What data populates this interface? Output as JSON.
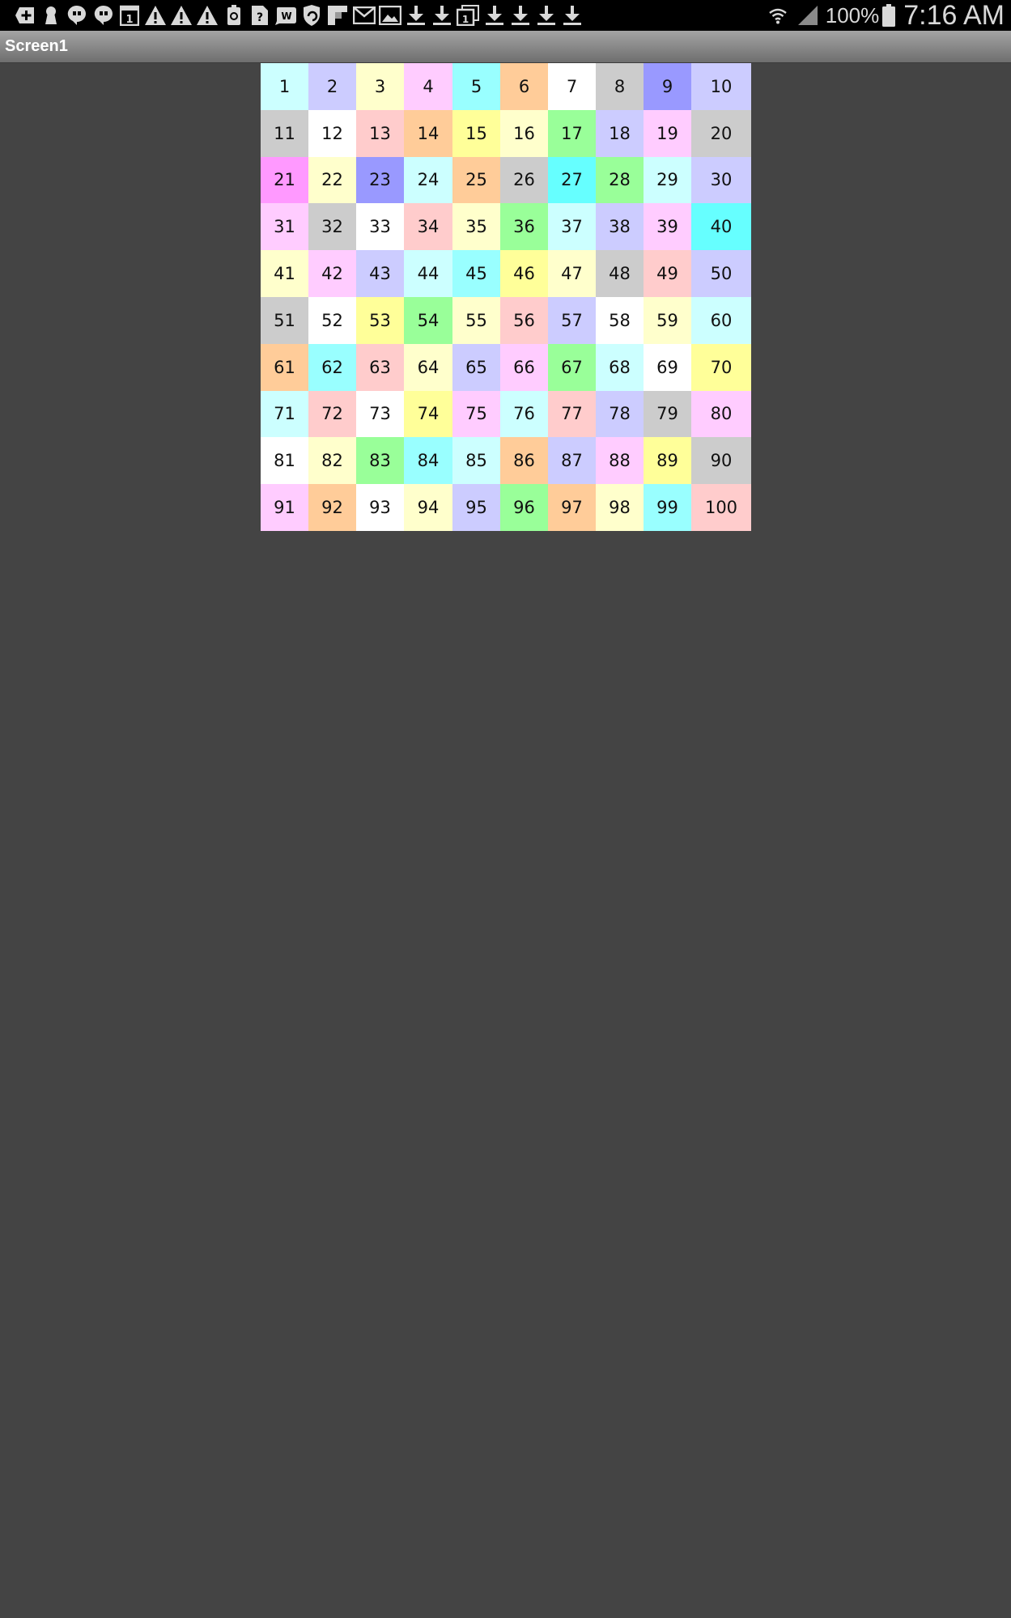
{
  "status_bar": {
    "notification_icons": [
      "add-box-icon",
      "keyhole-icon",
      "hangouts-icon",
      "hangouts-icon",
      "calendar-icon",
      "warning-icon",
      "warning-icon",
      "warning-icon",
      "battery-saver-icon",
      "help-doc-icon",
      "word-app-icon",
      "shield-refresh-icon",
      "flipboard-icon",
      "mail-icon",
      "image-icon",
      "download-icon",
      "download-icon",
      "calendar-stack-icon",
      "download-icon",
      "download-icon",
      "download-icon",
      "download-icon"
    ],
    "battery": "100%",
    "time": "7:16 AM"
  },
  "title_bar": {
    "title": "Screen1"
  },
  "colors": {
    "cyan_light": "#ccffff",
    "lavender": "#ccccff",
    "yellow_light": "#ffffcc",
    "pink": "#ffccff",
    "cyan": "#99ffff",
    "orange": "#ffcc99",
    "white": "#ffffff",
    "gray": "#cccccc",
    "blue": "#9999ff",
    "salmon": "#ffcccc",
    "yellow": "#ffff99",
    "green": "#99ff99",
    "magenta": "#ff99ff",
    "aqua": "#66ffff"
  },
  "grid": {
    "cells": [
      {
        "label": "1",
        "color": "#ccffff"
      },
      {
        "label": "2",
        "color": "#ccccff"
      },
      {
        "label": "3",
        "color": "#ffffcc"
      },
      {
        "label": "4",
        "color": "#ffccff"
      },
      {
        "label": "5",
        "color": "#99ffff"
      },
      {
        "label": "6",
        "color": "#ffcc99"
      },
      {
        "label": "7",
        "color": "#ffffff"
      },
      {
        "label": "8",
        "color": "#cccccc"
      },
      {
        "label": "9",
        "color": "#9999ff"
      },
      {
        "label": "10",
        "color": "#ccccff"
      },
      {
        "label": "11",
        "color": "#cccccc"
      },
      {
        "label": "12",
        "color": "#ffffff"
      },
      {
        "label": "13",
        "color": "#ffcccc"
      },
      {
        "label": "14",
        "color": "#ffcc99"
      },
      {
        "label": "15",
        "color": "#ffff99"
      },
      {
        "label": "16",
        "color": "#ffffcc"
      },
      {
        "label": "17",
        "color": "#99ff99"
      },
      {
        "label": "18",
        "color": "#ccccff"
      },
      {
        "label": "19",
        "color": "#ffccff"
      },
      {
        "label": "20",
        "color": "#cccccc"
      },
      {
        "label": "21",
        "color": "#ff99ff"
      },
      {
        "label": "22",
        "color": "#ffffcc"
      },
      {
        "label": "23",
        "color": "#9999ff"
      },
      {
        "label": "24",
        "color": "#ccffff"
      },
      {
        "label": "25",
        "color": "#ffcc99"
      },
      {
        "label": "26",
        "color": "#cccccc"
      },
      {
        "label": "27",
        "color": "#66ffff"
      },
      {
        "label": "28",
        "color": "#99ff99"
      },
      {
        "label": "29",
        "color": "#ccffff"
      },
      {
        "label": "30",
        "color": "#ccccff"
      },
      {
        "label": "31",
        "color": "#ffccff"
      },
      {
        "label": "32",
        "color": "#cccccc"
      },
      {
        "label": "33",
        "color": "#ffffff"
      },
      {
        "label": "34",
        "color": "#ffcccc"
      },
      {
        "label": "35",
        "color": "#ffffcc"
      },
      {
        "label": "36",
        "color": "#99ff99"
      },
      {
        "label": "37",
        "color": "#ccffff"
      },
      {
        "label": "38",
        "color": "#ccccff"
      },
      {
        "label": "39",
        "color": "#ffccff"
      },
      {
        "label": "40",
        "color": "#66ffff"
      },
      {
        "label": "41",
        "color": "#ffffcc"
      },
      {
        "label": "42",
        "color": "#ffccff"
      },
      {
        "label": "43",
        "color": "#ccccff"
      },
      {
        "label": "44",
        "color": "#ccffff"
      },
      {
        "label": "45",
        "color": "#99ffff"
      },
      {
        "label": "46",
        "color": "#ffff99"
      },
      {
        "label": "47",
        "color": "#ffffcc"
      },
      {
        "label": "48",
        "color": "#cccccc"
      },
      {
        "label": "49",
        "color": "#ffcccc"
      },
      {
        "label": "50",
        "color": "#ccccff"
      },
      {
        "label": "51",
        "color": "#cccccc"
      },
      {
        "label": "52",
        "color": "#ffffff"
      },
      {
        "label": "53",
        "color": "#ffff99"
      },
      {
        "label": "54",
        "color": "#99ff99"
      },
      {
        "label": "55",
        "color": "#ffffcc"
      },
      {
        "label": "56",
        "color": "#ffcccc"
      },
      {
        "label": "57",
        "color": "#ccccff"
      },
      {
        "label": "58",
        "color": "#ffffff"
      },
      {
        "label": "59",
        "color": "#ffffcc"
      },
      {
        "label": "60",
        "color": "#ccffff"
      },
      {
        "label": "61",
        "color": "#ffcc99"
      },
      {
        "label": "62",
        "color": "#99ffff"
      },
      {
        "label": "63",
        "color": "#ffcccc"
      },
      {
        "label": "64",
        "color": "#ffffcc"
      },
      {
        "label": "65",
        "color": "#ccccff"
      },
      {
        "label": "66",
        "color": "#ffccff"
      },
      {
        "label": "67",
        "color": "#99ff99"
      },
      {
        "label": "68",
        "color": "#ccffff"
      },
      {
        "label": "69",
        "color": "#ffffff"
      },
      {
        "label": "70",
        "color": "#ffff99"
      },
      {
        "label": "71",
        "color": "#ccffff"
      },
      {
        "label": "72",
        "color": "#ffcccc"
      },
      {
        "label": "73",
        "color": "#ffffff"
      },
      {
        "label": "74",
        "color": "#ffff99"
      },
      {
        "label": "75",
        "color": "#ffccff"
      },
      {
        "label": "76",
        "color": "#ccffff"
      },
      {
        "label": "77",
        "color": "#ffcccc"
      },
      {
        "label": "78",
        "color": "#ccccff"
      },
      {
        "label": "79",
        "color": "#cccccc"
      },
      {
        "label": "80",
        "color": "#ffccff"
      },
      {
        "label": "81",
        "color": "#ffffff"
      },
      {
        "label": "82",
        "color": "#ffffcc"
      },
      {
        "label": "83",
        "color": "#99ff99"
      },
      {
        "label": "84",
        "color": "#99ffff"
      },
      {
        "label": "85",
        "color": "#ccffff"
      },
      {
        "label": "86",
        "color": "#ffcc99"
      },
      {
        "label": "87",
        "color": "#ccccff"
      },
      {
        "label": "88",
        "color": "#ffccff"
      },
      {
        "label": "89",
        "color": "#ffff99"
      },
      {
        "label": "90",
        "color": "#cccccc"
      },
      {
        "label": "91",
        "color": "#ffccff"
      },
      {
        "label": "92",
        "color": "#ffcc99"
      },
      {
        "label": "93",
        "color": "#ffffff"
      },
      {
        "label": "94",
        "color": "#ffffcc"
      },
      {
        "label": "95",
        "color": "#ccccff"
      },
      {
        "label": "96",
        "color": "#99ff99"
      },
      {
        "label": "97",
        "color": "#ffcc99"
      },
      {
        "label": "98",
        "color": "#ffffcc"
      },
      {
        "label": "99",
        "color": "#99ffff"
      },
      {
        "label": "100",
        "color": "#ffcccc"
      }
    ]
  }
}
